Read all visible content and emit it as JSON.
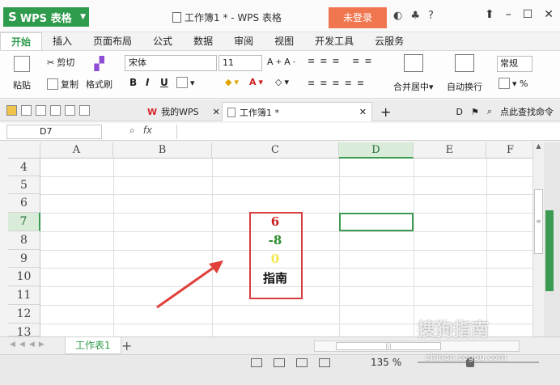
{
  "app": {
    "name": "WPS 表格",
    "window_title": "工作簿1 * - WPS 表格",
    "login_label": "未登录"
  },
  "ribbon_tabs": [
    "开始",
    "插入",
    "页面布局",
    "公式",
    "数据",
    "审阅",
    "视图",
    "开发工具",
    "云服务"
  ],
  "ribbon": {
    "paste": "粘贴",
    "cut": "剪切",
    "copy": "复制",
    "format_painter": "格式刷",
    "font_name": "宋体",
    "font_size": "11",
    "merge_center": "合并居中",
    "wrap_text": "自动换行",
    "number_format": "常规"
  },
  "doc_tabs": {
    "my_wps": "我的WPS",
    "workbook": "工作簿1 *",
    "search": "点此查找命令"
  },
  "formula_bar": {
    "name_box": "D7",
    "fx": "fx"
  },
  "columns": [
    "A",
    "B",
    "C",
    "D",
    "E",
    "F"
  ],
  "rows": [
    "4",
    "5",
    "6",
    "7",
    "8",
    "9",
    "10",
    "11",
    "12",
    "13"
  ],
  "cells": {
    "C7": {
      "value": "6",
      "color": "#cc1f1f"
    },
    "C8": {
      "value": "-8",
      "color": "#2a8c2a"
    },
    "C9": {
      "value": "0",
      "color": "#f2e64a"
    },
    "C10": {
      "value": "指南",
      "color": "#111111"
    }
  },
  "sheets": {
    "active": "工作表1"
  },
  "status": {
    "zoom": "135 %"
  },
  "watermark": {
    "text": "搜狗指南",
    "url": "zhinan.sogou.com"
  },
  "colors": {
    "accent": "#2f9b4c",
    "highlight_border": "#d73c3c",
    "login": "#f07650"
  }
}
